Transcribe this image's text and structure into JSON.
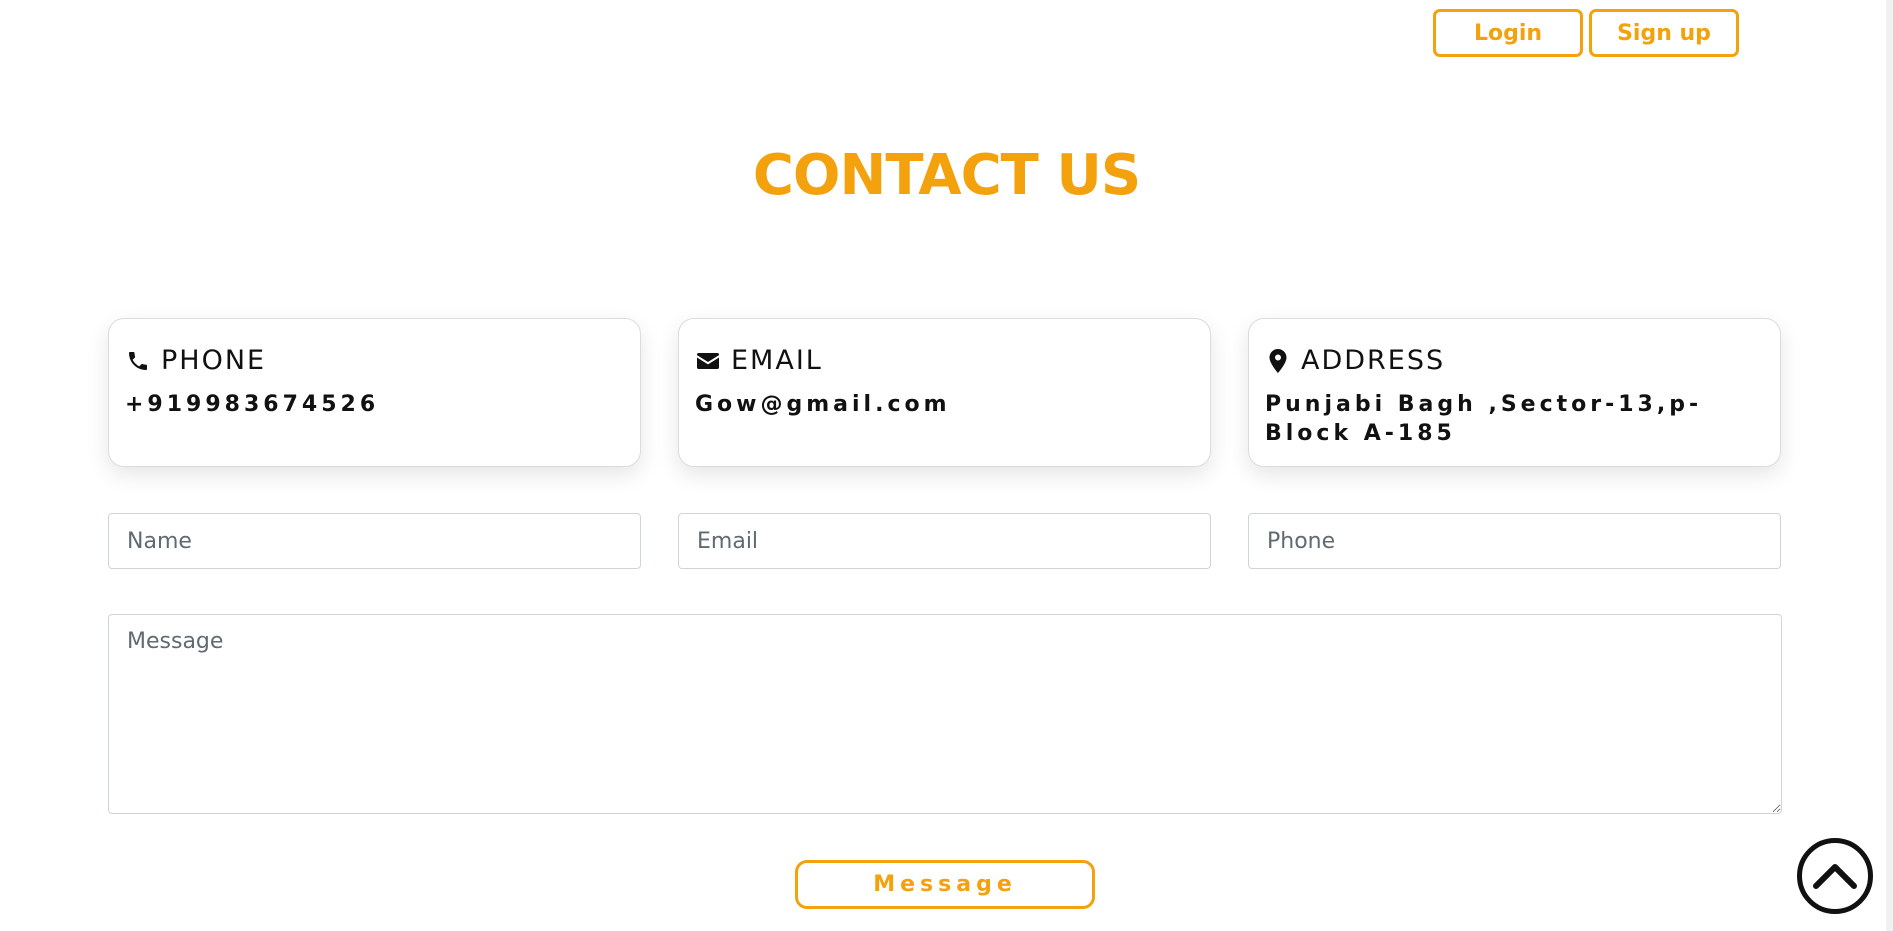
{
  "auth": {
    "login_label": "Login",
    "signup_label": "Sign up"
  },
  "page_title": "CONTACT US",
  "cards": {
    "phone": {
      "label": "PHONE",
      "value": "+919983674526",
      "icon": "phone-icon"
    },
    "email": {
      "label": "EMAIL",
      "value": "Gow@gmail.com",
      "icon": "envelope-icon"
    },
    "address": {
      "label": "ADDRESS",
      "value": "Punjabi Bagh ,Sector-13,p-Block A-185",
      "icon": "map-pin-icon"
    }
  },
  "form": {
    "name_placeholder": "Name",
    "email_placeholder": "Email",
    "phone_placeholder": "Phone",
    "message_placeholder": "Message",
    "submit_label": "Message"
  },
  "colors": {
    "accent": "#f4a10e",
    "text": "#111111",
    "border": "#cfd4d8"
  }
}
